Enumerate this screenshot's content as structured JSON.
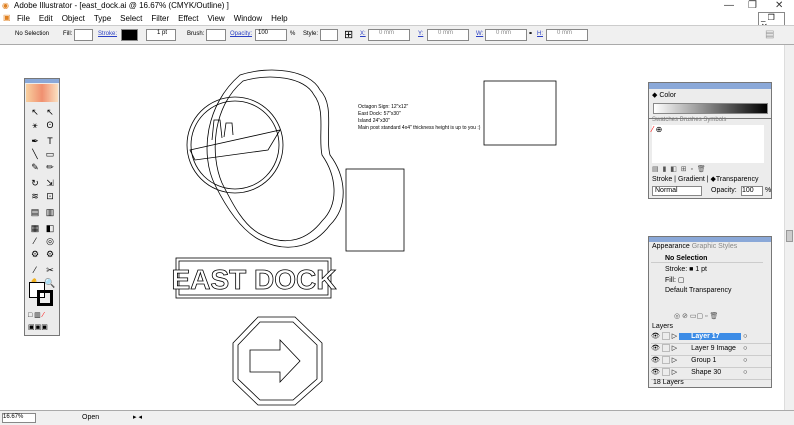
{
  "window": {
    "title": "Adobe Illustrator - [east_dock.ai @ 16.67% (CMYK/Outline) ]",
    "min": "—",
    "restore": "❐",
    "close": "✕"
  },
  "menu": [
    "File",
    "Edit",
    "Object",
    "Type",
    "Select",
    "Filter",
    "Effect",
    "View",
    "Window",
    "Help"
  ],
  "control": {
    "selection": "No Selection",
    "fill_label": "Fill:",
    "stroke_label": "Stroke:",
    "stroke_weight": "1 pt",
    "brush_label": "Brush:",
    "opacity_label": "Opacity:",
    "opacity": "100",
    "pct": "%",
    "style_label": "Style:",
    "x_label": "X:",
    "x": "0 mm",
    "y_label": "Y:",
    "y": "0 mm",
    "w_label": "W:",
    "w": "0 mm",
    "h_label": "H:",
    "h": "0 mm"
  },
  "artwork": {
    "notes": [
      "Octagon Sign: 12\"x12\"",
      "East Dock: 57\"x30\"",
      "Island 24\"x30\"",
      "Main post standard 4x4\" thickness height is up to you :)"
    ],
    "sign_text": "EAST DOCK"
  },
  "color_panel": {
    "tab": "Color"
  },
  "swatches_panel": {
    "tabs": [
      "Swatches",
      "Brushes",
      "Symbols"
    ]
  },
  "transparency_panel": {
    "tabs": [
      "Stroke",
      "Gradient",
      "Transparency"
    ],
    "blend_mode": "Normal",
    "opacity_label": "Opacity:",
    "opacity": "100",
    "pct": "%"
  },
  "appearance_panel": {
    "tabs": [
      "Appearance",
      "Graphic Styles"
    ],
    "selection": "No Selection",
    "stroke_label": "Stroke:",
    "stroke_value": "1 pt",
    "fill_label": "Fill:",
    "transparency": "Default Transparency"
  },
  "layers_panel": {
    "tab": "Layers",
    "layers": [
      {
        "name": "Layer 17",
        "selected": true
      },
      {
        "name": "Layer 9 Image",
        "selected": false
      },
      {
        "name": "Group 1",
        "selected": false
      },
      {
        "name": "Shape 30",
        "selected": false
      }
    ],
    "count": "18 Layers"
  },
  "status": {
    "zoom": "16.67%",
    "state": "Open"
  }
}
